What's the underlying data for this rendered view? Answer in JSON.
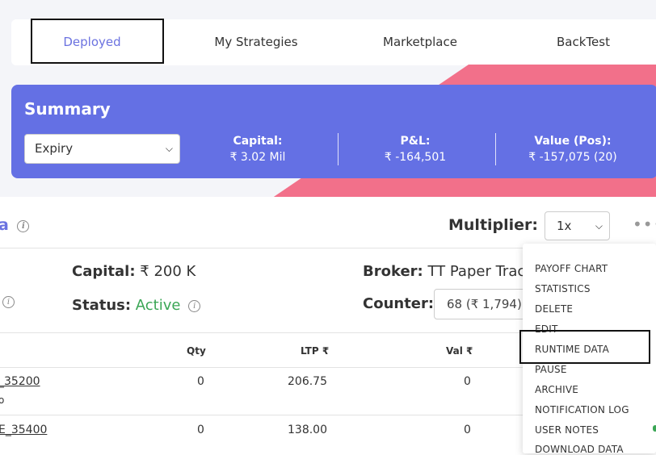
{
  "tabs": [
    {
      "label": "Deployed",
      "active": true
    },
    {
      "label": "My Strategies",
      "active": false
    },
    {
      "label": "Marketplace",
      "active": false
    },
    {
      "label": "BackTest",
      "active": false
    }
  ],
  "summary": {
    "title": "Summary",
    "expiry_value": "Expiry",
    "capital_label": "Capital:",
    "capital_value": "₹ 3.02 Mil",
    "pnl_label": "P&L:",
    "pnl_value": "₹ -164,501",
    "value_label": "Value (Pos):",
    "value_value": "₹ -157,075 (20)"
  },
  "strategy": {
    "name_fragment": "a",
    "multiplier_label": "Multiplier:",
    "multiplier_value": "1x",
    "more_icon": "more-horizontal-icon",
    "capital_label": "Capital:",
    "capital_value": "₹ 200 K",
    "status_label": "Status:",
    "status_value": "Active",
    "broker_label": "Broker:",
    "broker_value": "TT Paper Trac",
    "counter_label": "Counter:",
    "counter_value": "68 (₹ 1,794)"
  },
  "table": {
    "headers": {
      "qty": "Qty",
      "ltp": "LTP ₹",
      "val": "Val ₹"
    },
    "rows": [
      {
        "symbol": "_35200",
        "sub": "o",
        "qty": "0",
        "ltp": "206.75",
        "val": "0"
      },
      {
        "symbol": "E_35400",
        "sub": "",
        "qty": "0",
        "ltp": "138.00",
        "val": "0"
      }
    ]
  },
  "menu": {
    "items": [
      "PAYOFF CHART",
      "STATISTICS",
      "DELETE",
      "EDIT",
      "RUNTIME DATA",
      "PAUSE",
      "ARCHIVE",
      "NOTIFICATION LOG",
      "USER NOTES",
      "DOWNLOAD DATA"
    ]
  },
  "colors": {
    "accent": "#6470e4",
    "pink": "#f2708a",
    "active_green": "#3aa655"
  }
}
